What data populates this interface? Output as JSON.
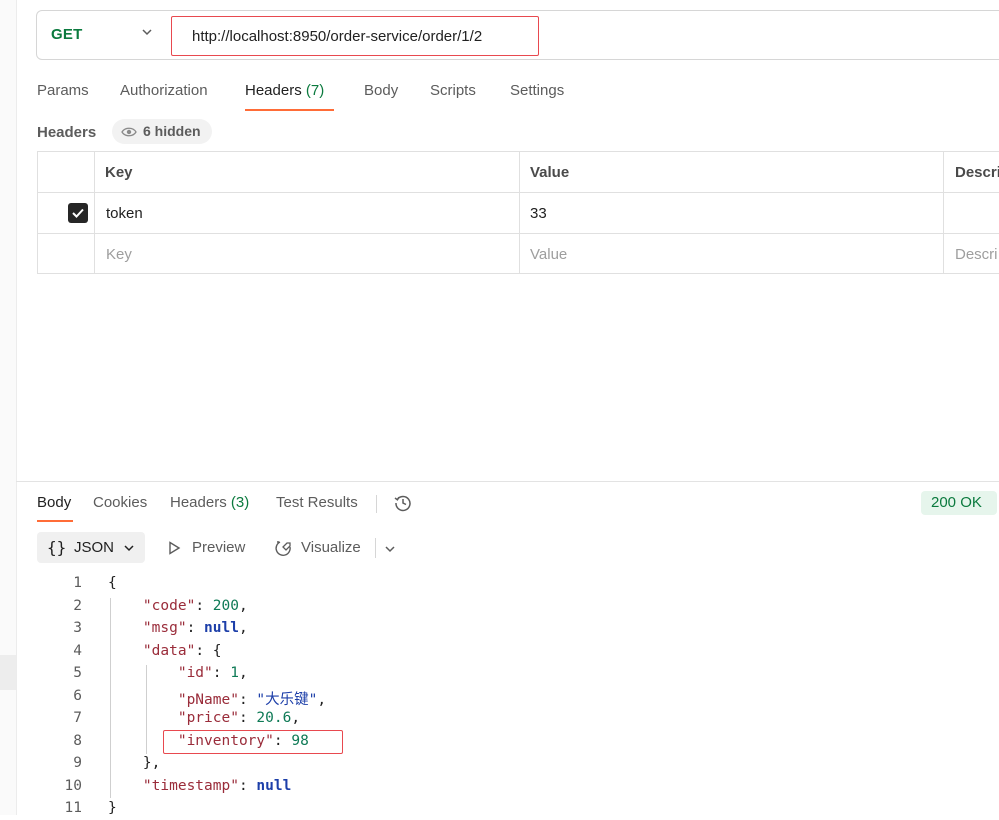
{
  "request": {
    "method": "GET",
    "url": "http://localhost:8950/order-service/order/1/2"
  },
  "request_tabs": [
    {
      "label": "Params"
    },
    {
      "label": "Authorization"
    },
    {
      "label": "Headers",
      "count": "(7)"
    },
    {
      "label": "Body"
    },
    {
      "label": "Scripts"
    },
    {
      "label": "Settings"
    }
  ],
  "headers_section": {
    "label": "Headers",
    "hidden_badge": "6 hidden"
  },
  "headers_table": {
    "columns": [
      "Key",
      "Value",
      "Descri"
    ],
    "rows": [
      {
        "checked": true,
        "key": "token",
        "value": "33",
        "description": ""
      }
    ],
    "placeholder": {
      "key": "Key",
      "value": "Value",
      "description": "Descri"
    }
  },
  "response_tabs": [
    {
      "label": "Body"
    },
    {
      "label": "Cookies"
    },
    {
      "label": "Headers",
      "count": "(3)"
    },
    {
      "label": "Test Results"
    }
  ],
  "status": "200 OK",
  "format_toolbar": {
    "braces": "{}",
    "format": "JSON",
    "preview": "Preview",
    "visualize": "Visualize"
  },
  "code_lines": [
    {
      "n": "1",
      "tokens": [
        {
          "t": "{",
          "c": "p"
        }
      ]
    },
    {
      "n": "2",
      "tokens": [
        {
          "t": "    ",
          "c": "p"
        },
        {
          "t": "\"code\"",
          "c": "k"
        },
        {
          "t": ": ",
          "c": "p"
        },
        {
          "t": "200",
          "c": "n"
        },
        {
          "t": ",",
          "c": "p"
        }
      ]
    },
    {
      "n": "3",
      "tokens": [
        {
          "t": "    ",
          "c": "p"
        },
        {
          "t": "\"msg\"",
          "c": "k"
        },
        {
          "t": ": ",
          "c": "p"
        },
        {
          "t": "null",
          "c": "kw"
        },
        {
          "t": ",",
          "c": "p"
        }
      ]
    },
    {
      "n": "4",
      "tokens": [
        {
          "t": "    ",
          "c": "p"
        },
        {
          "t": "\"data\"",
          "c": "k"
        },
        {
          "t": ": {",
          "c": "p"
        }
      ]
    },
    {
      "n": "5",
      "tokens": [
        {
          "t": "        ",
          "c": "p"
        },
        {
          "t": "\"id\"",
          "c": "k"
        },
        {
          "t": ": ",
          "c": "p"
        },
        {
          "t": "1",
          "c": "n"
        },
        {
          "t": ",",
          "c": "p"
        }
      ]
    },
    {
      "n": "6",
      "tokens": [
        {
          "t": "        ",
          "c": "p"
        },
        {
          "t": "\"pName\"",
          "c": "k"
        },
        {
          "t": ": ",
          "c": "p"
        },
        {
          "t": "\"大乐键\"",
          "c": "s"
        },
        {
          "t": ",",
          "c": "p"
        }
      ]
    },
    {
      "n": "7",
      "tokens": [
        {
          "t": "        ",
          "c": "p"
        },
        {
          "t": "\"price\"",
          "c": "k"
        },
        {
          "t": ": ",
          "c": "p"
        },
        {
          "t": "20.6",
          "c": "n"
        },
        {
          "t": ",",
          "c": "p"
        }
      ]
    },
    {
      "n": "8",
      "tokens": [
        {
          "t": "        ",
          "c": "p"
        },
        {
          "t": "\"inventory\"",
          "c": "k"
        },
        {
          "t": ": ",
          "c": "p"
        },
        {
          "t": "98",
          "c": "n"
        }
      ]
    },
    {
      "n": "9",
      "tokens": [
        {
          "t": "    ",
          "c": "p"
        },
        {
          "t": "},",
          "c": "p"
        }
      ]
    },
    {
      "n": "10",
      "tokens": [
        {
          "t": "    ",
          "c": "p"
        },
        {
          "t": "\"timestamp\"",
          "c": "k"
        },
        {
          "t": ": ",
          "c": "p"
        },
        {
          "t": "null",
          "c": "kw"
        }
      ]
    },
    {
      "n": "11",
      "tokens": [
        {
          "t": "}",
          "c": "p"
        }
      ]
    }
  ],
  "colors": {
    "accent": "#ff6c37",
    "method_get": "#0b7a3e",
    "highlight_box": "#e8494f",
    "status_bg": "#e6f5ec"
  }
}
